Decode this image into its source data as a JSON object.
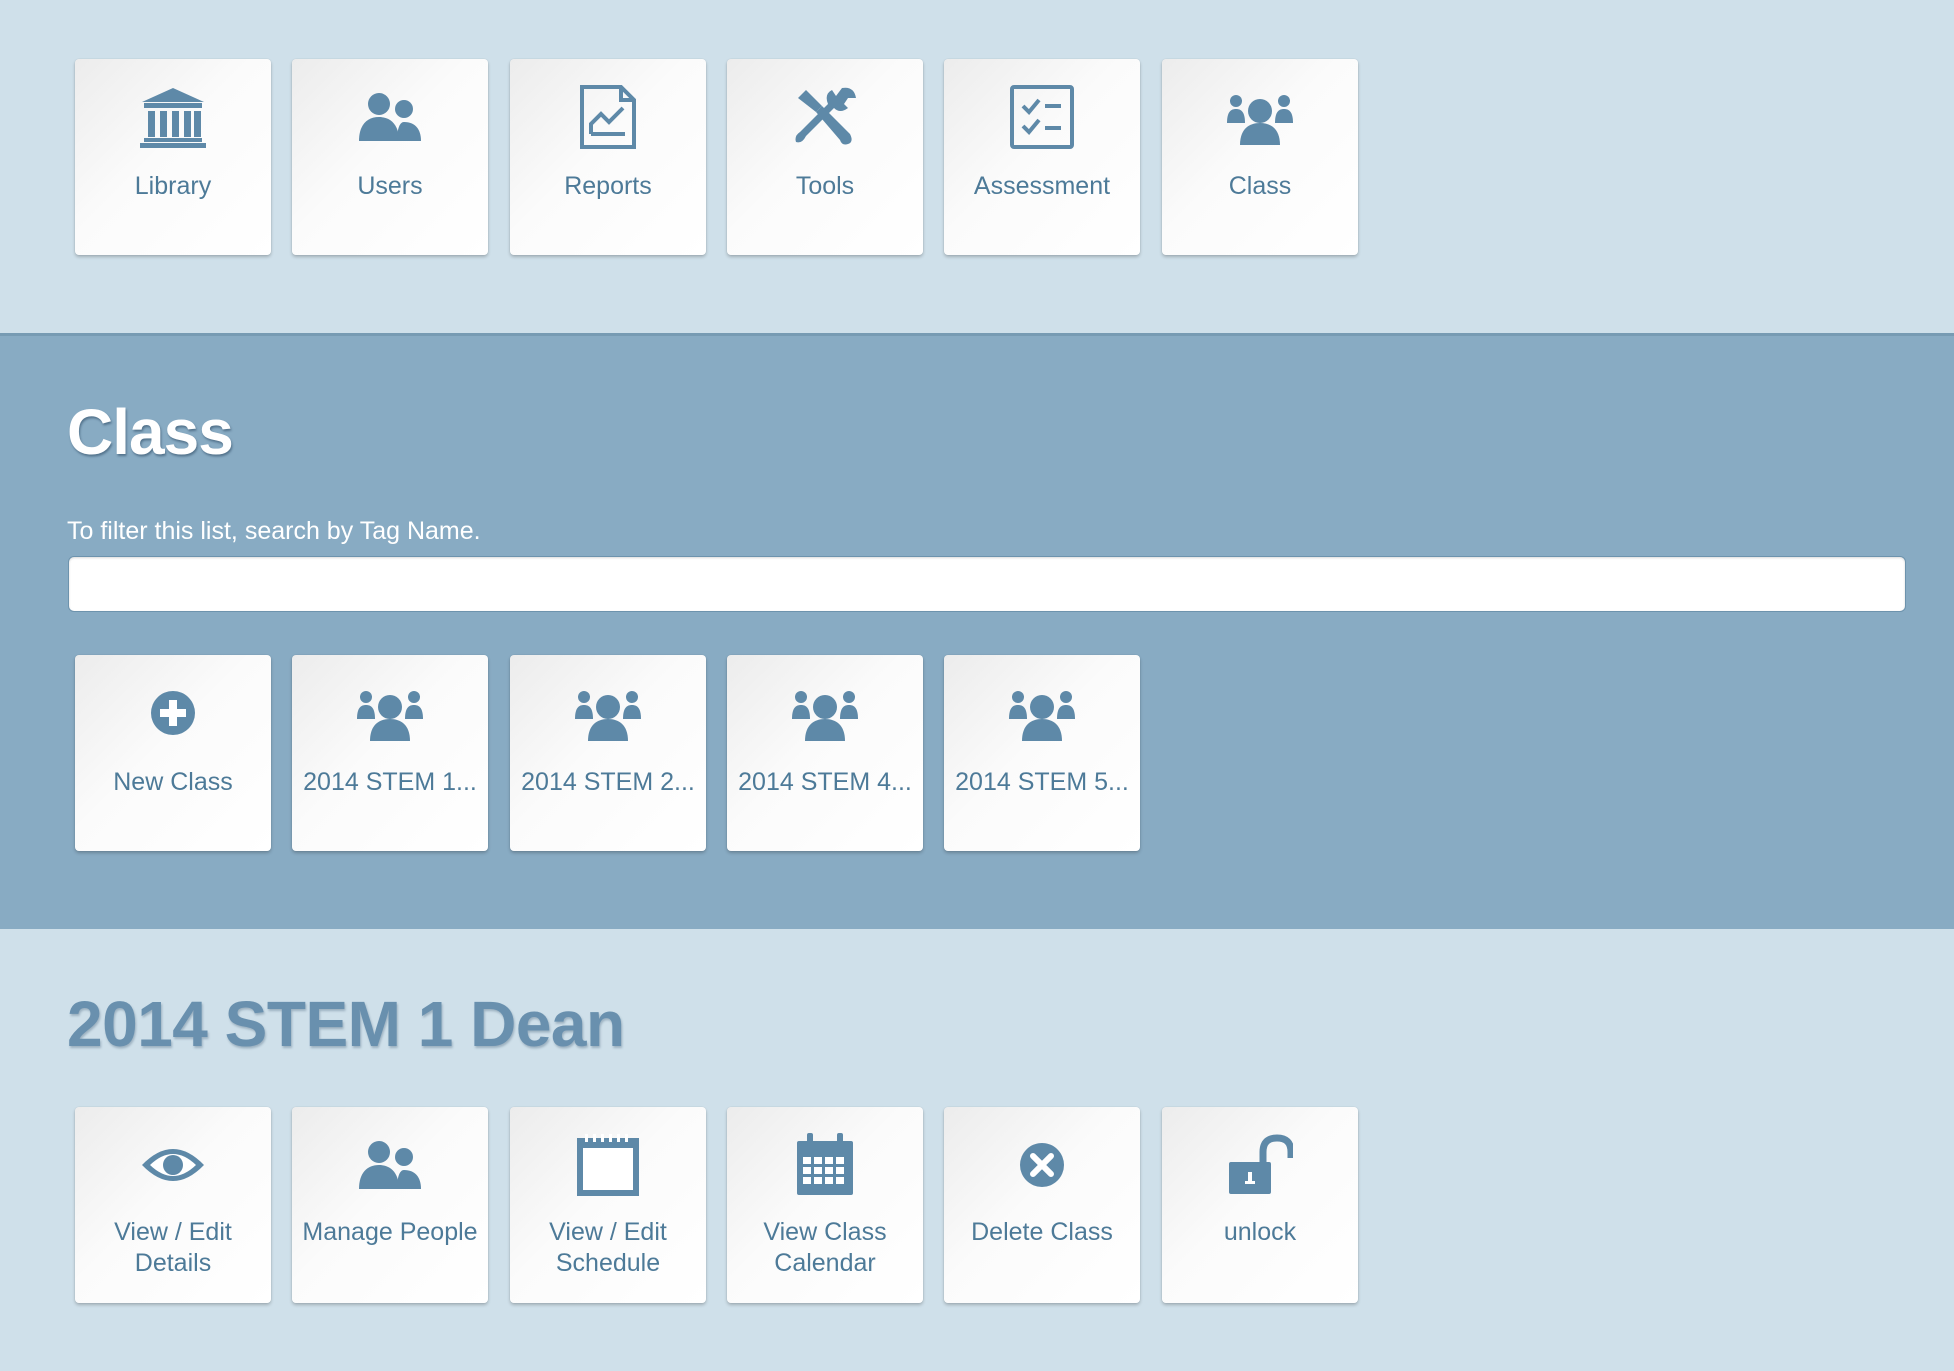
{
  "top_nav": {
    "items": [
      {
        "label": "Library",
        "icon": "library-icon"
      },
      {
        "label": "Users",
        "icon": "users-icon"
      },
      {
        "label": "Reports",
        "icon": "reports-icon"
      },
      {
        "label": "Tools",
        "icon": "tools-icon"
      },
      {
        "label": "Assessment",
        "icon": "assessment-icon"
      },
      {
        "label": "Class",
        "icon": "class-icon"
      }
    ]
  },
  "class_section": {
    "title": "Class",
    "filter_hint": "To filter this list, search by Tag Name.",
    "search_value": "",
    "tiles": [
      {
        "label": "New Class",
        "icon": "plus-circle-icon"
      },
      {
        "label": "2014 STEM 1...",
        "icon": "class-icon"
      },
      {
        "label": "2014 STEM 2...",
        "icon": "class-icon"
      },
      {
        "label": "2014 STEM 4...",
        "icon": "class-icon"
      },
      {
        "label": "2014 STEM 5...",
        "icon": "class-icon"
      }
    ]
  },
  "detail_section": {
    "title": "2014 STEM 1 Dean",
    "actions": [
      {
        "label": "View / Edit Details",
        "icon": "eye-icon"
      },
      {
        "label": "Manage People",
        "icon": "users-icon"
      },
      {
        "label": "View / Edit Schedule",
        "icon": "notepad-icon"
      },
      {
        "label": "View Class Calendar",
        "icon": "calendar-icon"
      },
      {
        "label": "Delete Class",
        "icon": "close-circle-icon"
      },
      {
        "label": "unlock",
        "icon": "unlock-icon"
      }
    ]
  },
  "colors": {
    "icon": "#5e89a8",
    "label": "#4d7a98",
    "band_light": "#cfe0ea",
    "band_dark": "#88abc3"
  }
}
